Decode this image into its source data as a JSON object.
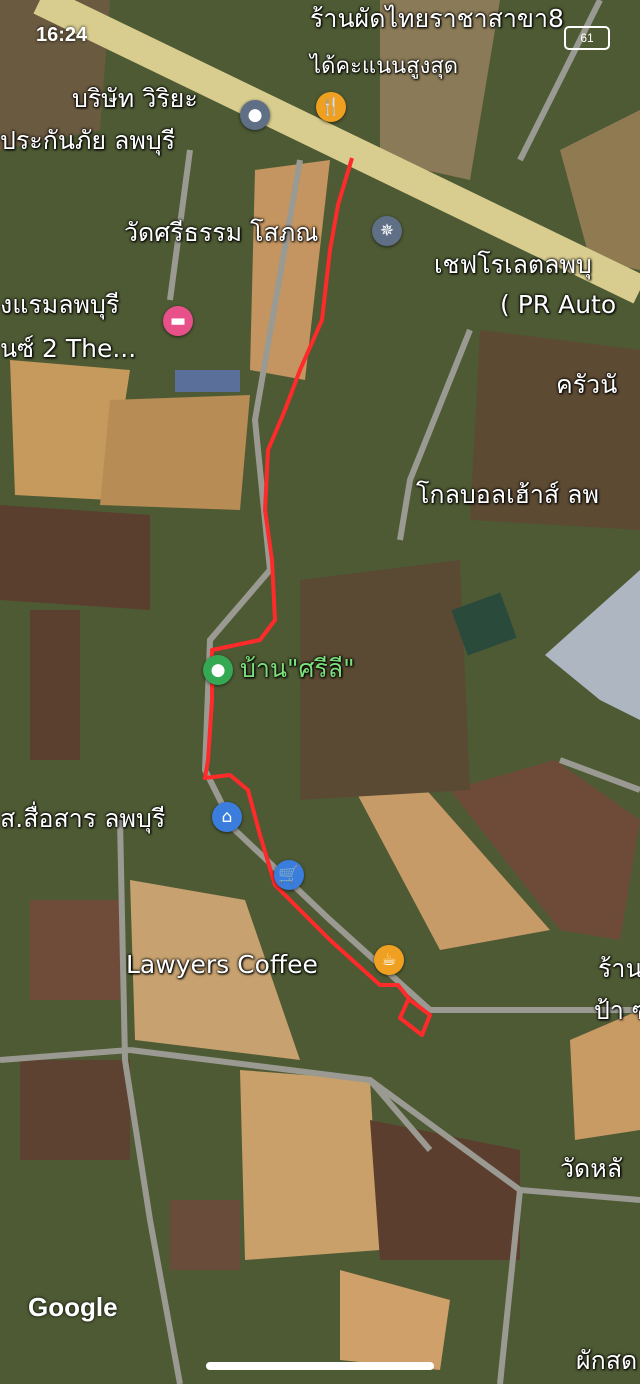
{
  "status_bar": {
    "time": "16:24",
    "battery": "61"
  },
  "brand": "Google",
  "pin_colors": {
    "place": "#5f6f86",
    "restaurant": "#f0a020",
    "temple": "#5f6f86",
    "hotel": "#e8508a",
    "home": "#34a853",
    "shop": "#3b7ddd",
    "cart": "#3b7ddd",
    "cafe": "#f0a020"
  },
  "route_color": "#ff2a2a",
  "places": [
    {
      "name": "ร้านผัดไทยราชาสาขา8",
      "subtitle": "ได้คะแนนสูงสุด",
      "icon": "restaurant-icon"
    },
    {
      "name": "บริษัท วิริยะ",
      "name2": "ประกันภัย ลพบุรี",
      "icon": "place-icon"
    },
    {
      "name": "วัดศรีธรรม โสภณ",
      "icon": "temple-icon"
    },
    {
      "name": "งแรมลพบุรี",
      "name2": "นซ์ 2 The...",
      "icon": "hotel-icon"
    },
    {
      "name": "เชฟโรเลตลพบุ",
      "name2": "( PR Auto"
    },
    {
      "name": "ครัวนั"
    },
    {
      "name": "โกลบอลเฮ้าส์ ลพ"
    },
    {
      "name": "บ้าน\"ศรีลี\"",
      "icon": "home-pin-icon"
    },
    {
      "name": "ส.สื่อสาร ลพบุรี",
      "icon": "shopping-bag-icon"
    },
    {
      "name": "Lawyers Coffee",
      "icon": "coffee-icon"
    },
    {
      "name": "ร้าน",
      "name2": "ป้า ซ"
    },
    {
      "name": "วัดหลั"
    },
    {
      "name": "ผักสด"
    }
  ]
}
